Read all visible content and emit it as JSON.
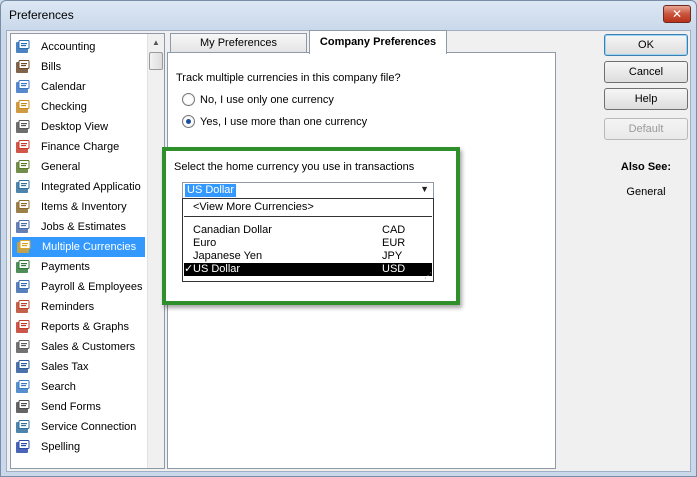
{
  "window": {
    "title": "Preferences",
    "close_glyph": "✕"
  },
  "sidebar": {
    "items": [
      {
        "label": "Accounting",
        "icon": "accounting-icon",
        "color": "#2b6fb5"
      },
      {
        "label": "Bills",
        "icon": "bills-icon",
        "color": "#6b4a2a"
      },
      {
        "label": "Calendar",
        "icon": "calendar-icon",
        "color": "#3a74c4"
      },
      {
        "label": "Checking",
        "icon": "checking-icon",
        "color": "#c78a1e"
      },
      {
        "label": "Desktop View",
        "icon": "desktop-view-icon",
        "color": "#555555"
      },
      {
        "label": "Finance Charge",
        "icon": "finance-charge-icon",
        "color": "#c93a2a"
      },
      {
        "label": "General",
        "icon": "general-icon",
        "color": "#5a7a2a"
      },
      {
        "label": "Integrated Applicatio",
        "icon": "integrated-applications-icon",
        "color": "#2f6e9e"
      },
      {
        "label": "Items & Inventory",
        "icon": "items-inventory-icon",
        "color": "#8a6a2a"
      },
      {
        "label": "Jobs & Estimates",
        "icon": "jobs-estimates-icon",
        "color": "#4a6aa8"
      },
      {
        "label": "Multiple Currencies",
        "icon": "multiple-currencies-icon",
        "color": "#d9a42a"
      },
      {
        "label": "Payments",
        "icon": "payments-icon",
        "color": "#2f7a3a"
      },
      {
        "label": "Payroll & Employees",
        "icon": "payroll-employees-icon",
        "color": "#3a6ab0"
      },
      {
        "label": "Reminders",
        "icon": "reminders-icon",
        "color": "#b8452a"
      },
      {
        "label": "Reports & Graphs",
        "icon": "reports-graphs-icon",
        "color": "#c23a2a"
      },
      {
        "label": "Sales & Customers",
        "icon": "sales-customers-icon",
        "color": "#5a5a5a"
      },
      {
        "label": "Sales Tax",
        "icon": "sales-tax-icon",
        "color": "#2a5a9a"
      },
      {
        "label": "Search",
        "icon": "search-icon",
        "color": "#3a7ac4"
      },
      {
        "label": "Send Forms",
        "icon": "send-forms-icon",
        "color": "#4a4a4a"
      },
      {
        "label": "Service Connection",
        "icon": "service-connection-icon",
        "color": "#2f6e9e"
      },
      {
        "label": "Spelling",
        "icon": "spelling-icon",
        "color": "#2a4aa8"
      }
    ],
    "selected": "Multiple Currencies"
  },
  "tabs": {
    "my_prefs": "My Preferences",
    "company_prefs": "Company Preferences",
    "active": "Company Preferences"
  },
  "panel": {
    "question": "Track multiple currencies in this company file?",
    "radio_no": "No, I use only one currency",
    "radio_yes": "Yes, I use more than one currency",
    "selected_radio": "yes",
    "home_currency_label": "Select the home currency you use in transactions",
    "combo_value": "US Dollar",
    "dropdown": {
      "view_more": "<View More Currencies>",
      "options": [
        {
          "name": "Canadian Dollar",
          "code": "CAD"
        },
        {
          "name": "Euro",
          "code": "EUR"
        },
        {
          "name": "Japanese Yen",
          "code": "JPY"
        },
        {
          "name": "US Dollar",
          "code": "USD",
          "check": "✓"
        }
      ]
    }
  },
  "buttons": {
    "ok": "OK",
    "cancel": "Cancel",
    "help": "Help",
    "default": "Default"
  },
  "also_see": {
    "heading": "Also See:",
    "link": "General"
  },
  "accent_color": "#2f8f2a",
  "selection_color": "#3399ff"
}
